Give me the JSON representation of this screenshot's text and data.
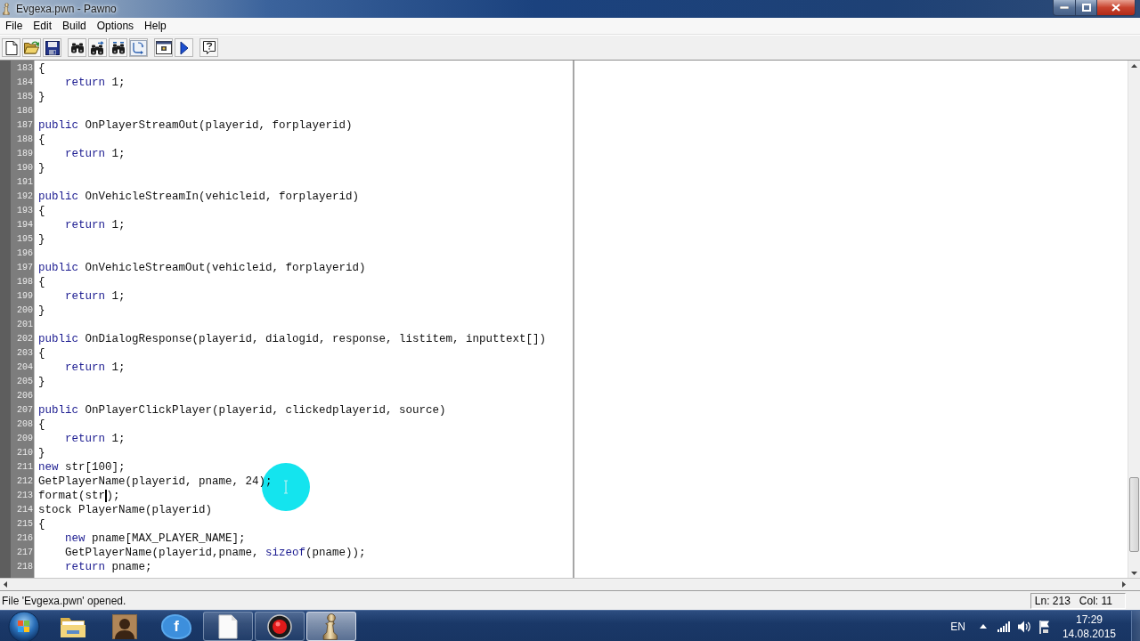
{
  "window": {
    "title": "Evgexa.pwn - Pawno"
  },
  "menu": [
    "File",
    "Edit",
    "Build",
    "Options",
    "Help"
  ],
  "editor": {
    "lines": [
      {
        "number": "183",
        "segments": [
          {
            "kind": "plain",
            "text": "{"
          }
        ],
        "children": [
          {
            "number": "184",
            "segments": [
              {
                "kind": "keyword",
                "text": "return"
              },
              {
                "kind": "plain",
                "text": " 1;"
              }
            ]
          }
        ]
      },
      {
        "number": "185",
        "segments": [
          {
            "kind": "plain",
            "text": "}"
          }
        ]
      },
      {
        "number": "186"
      },
      {
        "number": "187",
        "segments": [
          {
            "kind": "keyword",
            "text": "public"
          },
          {
            "kind": "plain",
            "text": " OnPlayerStreamOut(playerid, forplayerid)"
          }
        ]
      },
      {
        "number": "188",
        "segments": [
          {
            "kind": "plain",
            "text": "{"
          }
        ],
        "children": [
          {
            "number": "189",
            "segments": [
              {
                "kind": "keyword",
                "text": "return"
              },
              {
                "kind": "plain",
                "text": " 1;"
              }
            ]
          }
        ]
      },
      {
        "number": "190",
        "segments": [
          {
            "kind": "plain",
            "text": "}"
          }
        ]
      },
      {
        "number": "191"
      },
      {
        "number": "192",
        "segments": [
          {
            "kind": "keyword",
            "text": "public"
          },
          {
            "kind": "plain",
            "text": " OnVehicleStreamIn(vehicleid, forplayerid)"
          }
        ]
      },
      {
        "number": "193",
        "segments": [
          {
            "kind": "plain",
            "text": "{"
          }
        ],
        "children": [
          {
            "number": "194",
            "segments": [
              {
                "kind": "keyword",
                "text": "return"
              },
              {
                "kind": "plain",
                "text": " 1;"
              }
            ]
          }
        ]
      },
      {
        "number": "195",
        "segments": [
          {
            "kind": "plain",
            "text": "}"
          }
        ]
      },
      {
        "number": "196"
      },
      {
        "number": "197",
        "segments": [
          {
            "kind": "keyword",
            "text": "public"
          },
          {
            "kind": "plain",
            "text": " OnVehicleStreamOut(vehicleid, forplayerid)"
          }
        ]
      },
      {
        "number": "198",
        "segments": [
          {
            "kind": "plain",
            "text": "{"
          }
        ],
        "children": [
          {
            "number": "199",
            "segments": [
              {
                "kind": "keyword",
                "text": "return"
              },
              {
                "kind": "plain",
                "text": " 1;"
              }
            ]
          }
        ]
      },
      {
        "number": "200",
        "segments": [
          {
            "kind": "plain",
            "text": "}"
          }
        ]
      },
      {
        "number": "201"
      },
      {
        "number": "202",
        "segments": [
          {
            "kind": "keyword",
            "text": "public"
          },
          {
            "kind": "plain",
            "text": " OnDialogResponse(playerid, dialogid, response, listitem, inputtext[])"
          }
        ]
      },
      {
        "number": "203",
        "segments": [
          {
            "kind": "plain",
            "text": "{"
          }
        ],
        "children": [
          {
            "number": "204",
            "segments": [
              {
                "kind": "keyword",
                "text": "return"
              },
              {
                "kind": "plain",
                "text": " 1;"
              }
            ]
          }
        ]
      },
      {
        "number": "205",
        "segments": [
          {
            "kind": "plain",
            "text": "}"
          }
        ]
      },
      {
        "number": "206"
      },
      {
        "number": "207",
        "segments": [
          {
            "kind": "keyword",
            "text": "public"
          },
          {
            "kind": "plain",
            "text": " OnPlayerClickPlayer(playerid, clickedplayerid, source)"
          }
        ]
      },
      {
        "number": "208",
        "segments": [
          {
            "kind": "plain",
            "text": "{"
          }
        ],
        "children": [
          {
            "number": "209",
            "segments": [
              {
                "kind": "keyword",
                "text": "return"
              },
              {
                "kind": "plain",
                "text": " 1;"
              }
            ]
          }
        ]
      },
      {
        "number": "210",
        "segments": [
          {
            "kind": "plain",
            "text": "}"
          }
        ]
      },
      {
        "number": "211",
        "segments": [
          {
            "kind": "keyword",
            "text": "new"
          },
          {
            "kind": "plain",
            "text": " str[100];"
          }
        ]
      },
      {
        "number": "212",
        "segments": [
          {
            "kind": "plain",
            "text": "GetPlayerName(playerid, pname, 24);"
          }
        ]
      },
      {
        "number": "213",
        "segments": [
          {
            "kind": "plain",
            "text": "format(str"
          },
          {
            "kind": "caret"
          },
          {
            "kind": "plain",
            "text": ");"
          }
        ]
      },
      {
        "number": "214",
        "segments": [
          {
            "kind": "plain",
            "text": "stock PlayerName(playerid)"
          }
        ]
      },
      {
        "number": "215",
        "segments": [
          {
            "kind": "plain",
            "text": "{"
          }
        ],
        "children": [
          {
            "number": "216",
            "segments": [
              {
                "kind": "keyword",
                "text": "new"
              },
              {
                "kind": "plain",
                "text": " pname[MAX_PLAYER_NAME];"
              }
            ]
          },
          {
            "number": "217",
            "segments": [
              {
                "kind": "plain",
                "text": "GetPlayerName(playerid,pname, "
              },
              {
                "kind": "keyword",
                "text": "sizeof"
              },
              {
                "kind": "plain",
                "text": "(pname));"
              }
            ]
          },
          {
            "number": "218",
            "segments": [
              {
                "kind": "keyword",
                "text": "return"
              },
              {
                "kind": "plain",
                "text": " pname;"
              }
            ]
          }
        ]
      }
    ]
  },
  "status_bar": {
    "message": "File 'Evgexa.pwn' opened.",
    "line": "Ln: 213",
    "column": "Col: 11"
  },
  "taskbar": {
    "apps": [
      {
        "kind": "folder",
        "running": false,
        "selected": false
      },
      {
        "kind": "game",
        "running": false,
        "selected": false
      },
      {
        "kind": "social",
        "label": "f",
        "running": false,
        "selected": false
      },
      {
        "kind": "document",
        "running": true,
        "selected": false
      },
      {
        "kind": "recorder",
        "running": true,
        "selected": false
      },
      {
        "kind": "pawn",
        "running": true,
        "selected": true
      }
    ],
    "language": "EN",
    "time": "17:29",
    "date": "14.08.2015"
  }
}
